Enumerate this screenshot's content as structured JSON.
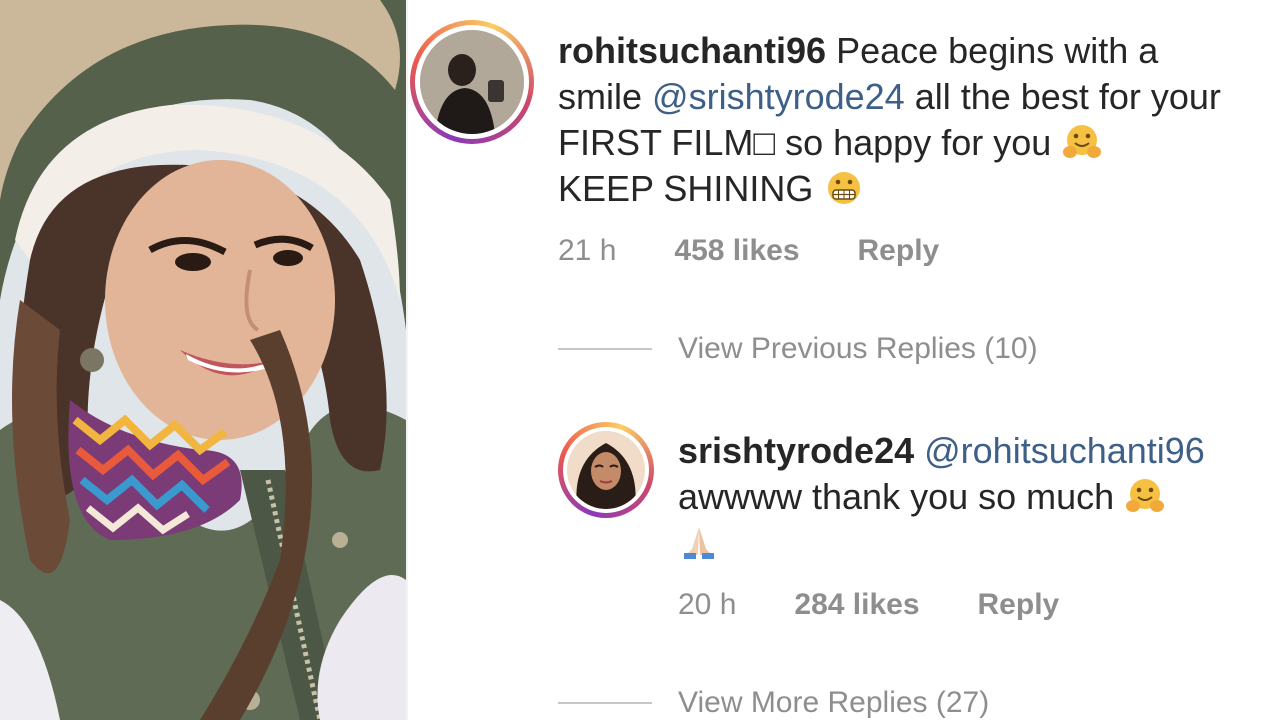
{
  "comment_main": {
    "username": "rohitsuchanti96",
    "text_before_mention": "Peace begins with a smile",
    "mention": "@srishtyrode24",
    "text_after_mention": "all the best for your FIRST FILM□ so happy for you",
    "text_tail": "KEEP SHINING",
    "emoji_1": "hugging-face-emoji",
    "emoji_2": "grimacing-face-emoji",
    "time": "21 h",
    "likes": "458 likes",
    "reply_label": "Reply"
  },
  "view_previous": "View Previous Replies (10)",
  "comment_reply": {
    "username": "srishtyrode24",
    "mention": "@rohitsuchanti96",
    "text": "awwww thank you so much",
    "emoji_1": "hugging-face-emoji",
    "emoji_2": "folded-hands-emoji",
    "time": "20 h",
    "likes": "284 likes",
    "reply_label": "Reply"
  },
  "view_more": "View More Replies (27)",
  "colors": {
    "mention": "#3d5f88",
    "meta_gray": "#8e8e8e",
    "text": "#262626"
  }
}
